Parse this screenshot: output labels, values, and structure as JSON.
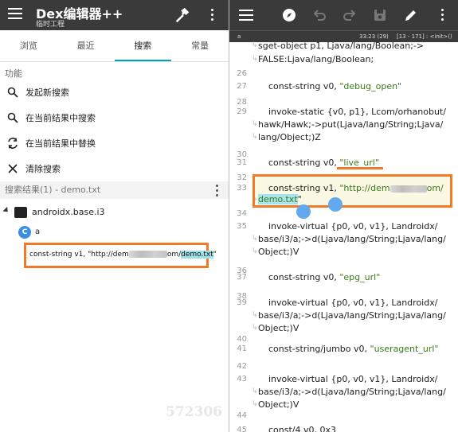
{
  "left": {
    "app_title": "Dex编辑器++",
    "app_subtitle": "临时工程",
    "tabs": [
      {
        "label": "浏览"
      },
      {
        "label": "最近"
      },
      {
        "label": "搜索"
      },
      {
        "label": "常量"
      }
    ],
    "active_tab": "搜索",
    "functions_label": "功能",
    "functions": [
      {
        "label": "发起新搜索",
        "icon": "search-icon"
      },
      {
        "label": "在当前结果中搜索",
        "icon": "search-in-results-icon"
      },
      {
        "label": "在当前结果中替换",
        "icon": "replace-icon"
      },
      {
        "label": "清除搜索",
        "icon": "close-icon"
      }
    ],
    "results_header": "搜索结果(1) - demo.txt",
    "tree": {
      "package": "androidx.base.i3",
      "class_badge": "C",
      "class_name": "a",
      "match_prefix": "const-string v1, \"http://dem",
      "match_middle": "om/",
      "match_highlight": "demo.txt",
      "match_suffix": "\""
    },
    "watermark": "572306"
  },
  "right": {
    "status_file": "a",
    "status_pos": "33:23 (29)",
    "status_range": "[13 - 171] : <init>()",
    "lines": [
      {
        "n": "",
        "parts": [
          [
            "kw",
            "sget-object "
          ],
          [
            "kw",
            "p1, Ljava/lang/Boolean;->"
          ]
        ]
      },
      {
        "n": "",
        "parts": [
          [
            "kw",
            "FALSE:Ljava/lang/Boolean;"
          ]
        ]
      },
      {
        "n": "26",
        "parts": []
      },
      {
        "n": "27",
        "parts": [
          [
            "kw",
            "const-string "
          ],
          [
            "kw",
            "v0, "
          ],
          [
            "str",
            "\"debug_open\""
          ]
        ]
      },
      {
        "n": "28",
        "parts": []
      },
      {
        "n": "29",
        "parts": [
          [
            "kw",
            "invoke-static "
          ],
          [
            "kw",
            "{v0, p1}, Lcom/orhanobut/"
          ]
        ]
      },
      {
        "n": "",
        "parts": [
          [
            "kw",
            "hawk/Hawk;->put(Ljava/lang/String;Ljava/"
          ]
        ]
      },
      {
        "n": "",
        "parts": [
          [
            "kw",
            "lang/Object;)Z"
          ]
        ]
      },
      {
        "n": "30",
        "parts": []
      },
      {
        "n": "31",
        "parts": [
          [
            "kw",
            "const-string "
          ],
          [
            "kw",
            "v0, "
          ],
          [
            "str",
            "\"live_url\""
          ]
        ]
      },
      {
        "n": "32",
        "parts": []
      },
      {
        "n": "33",
        "parts": [
          [
            "kw",
            "const-string "
          ],
          [
            "kw",
            "v1, "
          ],
          [
            "str",
            "\"http://dem"
          ]
        ]
      },
      {
        "n": "",
        "parts": [
          [
            "str",
            "demo.txt"
          ],
          [
            "kw",
            "\""
          ]
        ]
      },
      {
        "n": "34",
        "parts": []
      },
      {
        "n": "35",
        "parts": [
          [
            "kw",
            "invoke-virtual "
          ],
          [
            "kw",
            "{p0, v0, v1}, Landroidx/"
          ]
        ]
      },
      {
        "n": "",
        "parts": [
          [
            "kw",
            "base/i3/a;->d(Ljava/lang/String;Ljava/lang/"
          ]
        ]
      },
      {
        "n": "",
        "parts": [
          [
            "kw",
            "Object;)V"
          ]
        ]
      },
      {
        "n": "36",
        "parts": []
      },
      {
        "n": "37",
        "parts": [
          [
            "kw",
            "const-string "
          ],
          [
            "kw",
            "v0, "
          ],
          [
            "str",
            "\"epg_url\""
          ]
        ]
      },
      {
        "n": "38",
        "parts": []
      },
      {
        "n": "39",
        "parts": [
          [
            "kw",
            "invoke-virtual "
          ],
          [
            "kw",
            "{p0, v0, v1}, Landroidx/"
          ]
        ]
      },
      {
        "n": "",
        "parts": [
          [
            "kw",
            "base/i3/a;->d(Ljava/lang/String;Ljava/lang/"
          ]
        ]
      },
      {
        "n": "",
        "parts": [
          [
            "kw",
            "Object;)V"
          ]
        ]
      },
      {
        "n": "40",
        "parts": []
      },
      {
        "n": "41",
        "parts": [
          [
            "kw",
            "const-string/jumbo "
          ],
          [
            "kw",
            "v0, "
          ],
          [
            "str",
            "\"useragent_url\""
          ]
        ]
      },
      {
        "n": "42",
        "parts": []
      },
      {
        "n": "43",
        "parts": [
          [
            "kw",
            "invoke-virtual "
          ],
          [
            "kw",
            "{p0, v0, v1}, Landroidx/"
          ]
        ]
      },
      {
        "n": "",
        "parts": [
          [
            "kw",
            "base/i3/a;->d(Ljava/lang/String;Ljava/lang/"
          ]
        ]
      },
      {
        "n": "",
        "parts": [
          [
            "kw",
            "Object;)V"
          ]
        ]
      },
      {
        "n": "44",
        "parts": []
      },
      {
        "n": "45",
        "parts": [
          [
            "kw",
            "const/4 "
          ],
          [
            "kw",
            "v0, 0x3"
          ]
        ]
      }
    ]
  },
  "colors": {
    "toolbar_bg": "#3a3a3a",
    "accent": "#00a3c4",
    "highlight_box": "#f07a28",
    "string_green": "#3a7a1c"
  }
}
